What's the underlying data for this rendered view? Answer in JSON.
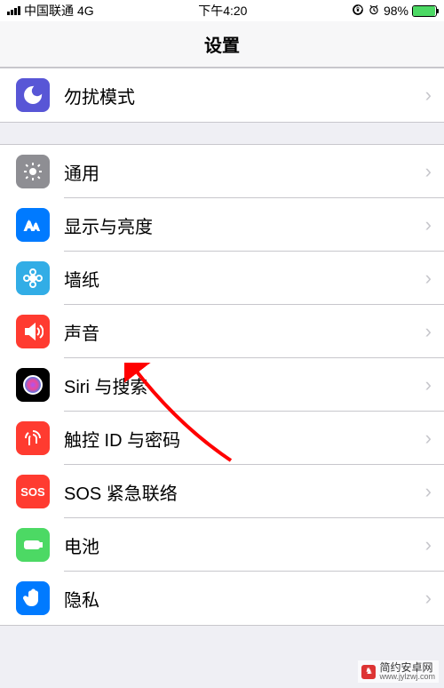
{
  "status": {
    "carrier": "中国联通",
    "network": "4G",
    "time": "下午4:20",
    "battery_pct": "98%"
  },
  "header": {
    "title": "设置"
  },
  "groups": [
    {
      "rows": [
        {
          "id": "dnd",
          "label": "勿扰模式",
          "icon": "moon-icon",
          "bg": "bg-purple"
        }
      ]
    },
    {
      "rows": [
        {
          "id": "general",
          "label": "通用",
          "icon": "gear-icon",
          "bg": "bg-gray"
        },
        {
          "id": "display",
          "label": "显示与亮度",
          "icon": "text-size-icon",
          "bg": "bg-blue"
        },
        {
          "id": "wallpaper",
          "label": "墙纸",
          "icon": "flower-icon",
          "bg": "bg-cyan"
        },
        {
          "id": "sound",
          "label": "声音",
          "icon": "speaker-icon",
          "bg": "bg-red"
        },
        {
          "id": "siri",
          "label": "Siri 与搜索",
          "icon": "siri-icon",
          "bg": "bg-black"
        },
        {
          "id": "touchid",
          "label": "触控 ID 与密码",
          "icon": "fingerprint-icon",
          "bg": "bg-red"
        },
        {
          "id": "sos",
          "label": "SOS 紧急联络",
          "icon": "sos-icon",
          "bg": "bg-red"
        },
        {
          "id": "battery",
          "label": "电池",
          "icon": "battery-icon",
          "bg": "bg-green"
        },
        {
          "id": "privacy",
          "label": "隐私",
          "icon": "hand-icon",
          "bg": "bg-blue"
        }
      ]
    }
  ],
  "watermark": {
    "name": "简约安卓网",
    "url": "www.jylzwj.com"
  }
}
